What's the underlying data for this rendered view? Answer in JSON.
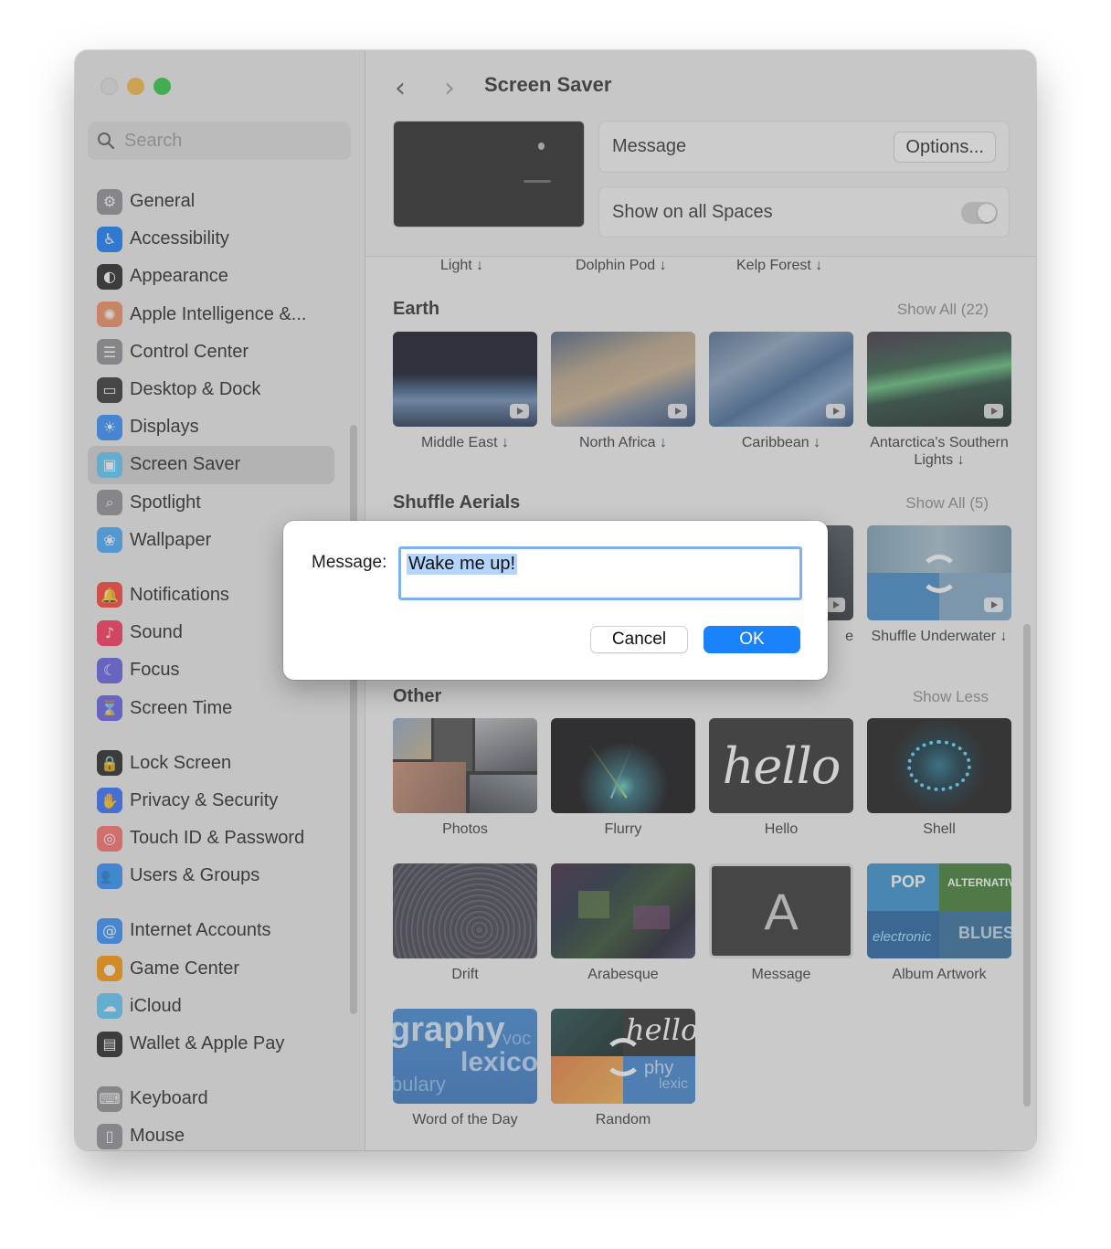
{
  "window": {
    "traffic_lights": {
      "close": "#e2e2e2",
      "minimize": "#f6b93f",
      "zoom": "#27c840"
    }
  },
  "sidebar": {
    "search_placeholder": "Search",
    "groups": [
      [
        {
          "label": "General",
          "icon": "gear-icon",
          "color": "#8e8e93"
        },
        {
          "label": "Accessibility",
          "icon": "accessibility-icon",
          "color": "#0a7aff"
        },
        {
          "label": "Appearance",
          "icon": "appearance-icon",
          "color": "#1d1d1f"
        },
        {
          "label": "Apple Intelligence &...",
          "icon": "apple-intelligence-icon",
          "color": "#f08a5d"
        },
        {
          "label": "Control Center",
          "icon": "control-center-icon",
          "color": "#8e8e93"
        },
        {
          "label": "Desktop & Dock",
          "icon": "dock-icon",
          "color": "#2c2c2e"
        },
        {
          "label": "Displays",
          "icon": "sun-icon",
          "color": "#2b8cff"
        },
        {
          "label": "Screen Saver",
          "icon": "screen-saver-icon",
          "color": "#5ac8fa",
          "selected": true
        },
        {
          "label": "Spotlight",
          "icon": "spotlight-icon",
          "color": "#8e8e93"
        },
        {
          "label": "Wallpaper",
          "icon": "wallpaper-icon",
          "color": "#40a9ff"
        }
      ],
      [
        {
          "label": "Notifications",
          "icon": "bell-icon",
          "color": "#ff3b30"
        },
        {
          "label": "Sound",
          "icon": "speaker-icon",
          "color": "#ff2d55"
        },
        {
          "label": "Focus",
          "icon": "moon-icon",
          "color": "#5e5ce6"
        },
        {
          "label": "Screen Time",
          "icon": "hourglass-icon",
          "color": "#5e5ce6"
        }
      ],
      [
        {
          "label": "Lock Screen",
          "icon": "lock-icon",
          "color": "#1d1d1f"
        },
        {
          "label": "Privacy & Security",
          "icon": "hand-icon",
          "color": "#2b6cff"
        },
        {
          "label": "Touch ID & Password",
          "icon": "fingerprint-icon",
          "color": "#ff6b6b"
        },
        {
          "label": "Users & Groups",
          "icon": "users-icon",
          "color": "#2b8cff"
        }
      ],
      [
        {
          "label": "Internet Accounts",
          "icon": "at-icon",
          "color": "#2b8cff"
        },
        {
          "label": "Game Center",
          "icon": "game-center-icon",
          "color": "#ff9500"
        },
        {
          "label": "iCloud",
          "icon": "cloud-icon",
          "color": "#5ac8fa"
        },
        {
          "label": "Wallet & Apple Pay",
          "icon": "wallet-icon",
          "color": "#1d1d1f"
        }
      ],
      [
        {
          "label": "Keyboard",
          "icon": "keyboard-icon",
          "color": "#8e8e93"
        },
        {
          "label": "Mouse",
          "icon": "mouse-icon",
          "color": "#8e8e93"
        }
      ]
    ]
  },
  "header": {
    "back_icon": "chevron-left-icon",
    "forward_icon": "chevron-right-icon",
    "title": "Screen Saver"
  },
  "settings": {
    "saver_label": "Message",
    "options_button": "Options...",
    "show_all_spaces_label": "Show on all Spaces",
    "show_all_spaces_on": true
  },
  "top_row": [
    "Light ↓",
    "Dolphin Pod ↓",
    "Kelp Forest ↓"
  ],
  "sections": {
    "earth": {
      "title": "Earth",
      "show_all": "Show All (22)",
      "items": [
        "Middle East ↓",
        "North Africa ↓",
        "Caribbean ↓",
        "Antarctica's Southern Lights ↓"
      ]
    },
    "shuffle": {
      "title": "Shuffle Aerials",
      "show_all": "Show All (5)",
      "partial_caption": "e",
      "last_item": "Shuffle Underwater ↓"
    },
    "other": {
      "title": "Other",
      "show_less": "Show Less",
      "items": [
        "Photos",
        "Flurry",
        "Hello",
        "Shell",
        "Drift",
        "Arabesque",
        "Message",
        "Album Artwork",
        "Word of the Day",
        "Random"
      ],
      "hello_text": "hello",
      "message_letter": "A",
      "album_words": [
        "POP",
        "ALTERNATIVE",
        "electronic",
        "BLUES"
      ],
      "word_tile_words": [
        "graphy",
        "voc",
        "lexico",
        "bulary"
      ],
      "random_words": [
        "hello",
        "phy",
        "lexic"
      ]
    }
  },
  "dialog": {
    "label": "Message:",
    "value": "Wake me up!",
    "cancel": "Cancel",
    "ok": "OK",
    "accent": "#1a82fb"
  }
}
